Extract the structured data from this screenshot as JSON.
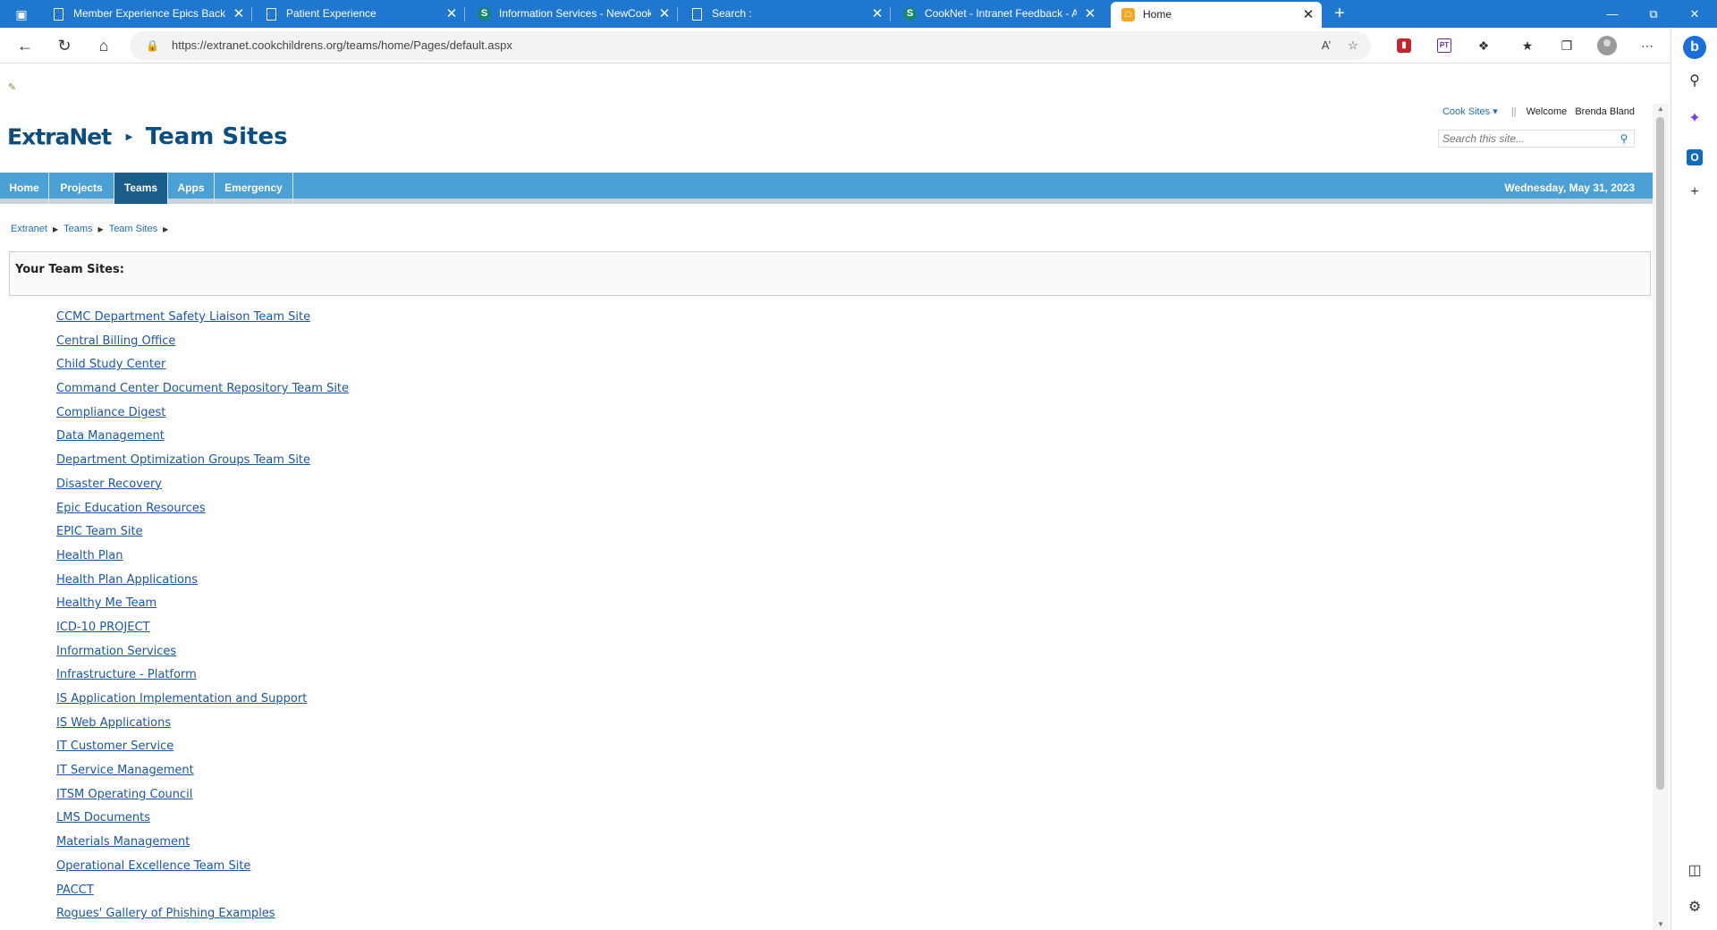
{
  "browser": {
    "tabs": [
      {
        "title": "Member Experience Epics Backlog",
        "icon": "page-icon",
        "active": false
      },
      {
        "title": "Patient Experience",
        "icon": "page-icon",
        "active": false
      },
      {
        "title": "Information Services - NewCookNet",
        "icon": "sharepoint-icon",
        "active": false
      },
      {
        "title": "Search :",
        "icon": "page-icon",
        "active": false
      },
      {
        "title": "CookNet - Intranet Feedback - All",
        "icon": "sharepoint-icon",
        "active": false
      },
      {
        "title": "Home",
        "icon": "home-favicon",
        "active": true
      }
    ],
    "address_url": "https://extranet.cookchildrens.org/teams/home/Pages/default.aspx",
    "accent_color": "#1f77d0"
  },
  "page": {
    "top_links": {
      "sites_menu": "Cook Sites",
      "welcome_label": "Welcome",
      "user_name": "Brenda Bland"
    },
    "brand": {
      "logo_text": "ExtraNet",
      "site_title": "Team Sites"
    },
    "search": {
      "placeholder": "Search this site..."
    },
    "nav": {
      "items": [
        {
          "label": "Home",
          "active": false
        },
        {
          "label": "Projects",
          "active": false
        },
        {
          "label": "Teams",
          "active": true
        },
        {
          "label": "Apps",
          "active": false
        },
        {
          "label": "Emergency",
          "active": false
        }
      ],
      "date": "Wednesday, May 31, 2023",
      "bar_color": "#4ba1d6",
      "active_color": "#1c5e8a"
    },
    "breadcrumb": [
      "Extranet",
      "Teams",
      "Team Sites"
    ],
    "panel_title": "Your Team Sites:",
    "team_sites": [
      "CCMC Department Safety Liaison Team Site",
      "Central Billing Office",
      "Child Study Center",
      "Command Center Document Repository Team Site",
      "Compliance Digest",
      "Data Management",
      "Department Optimization Groups Team Site",
      "Disaster Recovery",
      "Epic Education Resources",
      "EPIC Team Site",
      "Health Plan",
      "Health Plan Applications",
      "Healthy Me Team",
      "ICD-10 PROJECT",
      "Information Services",
      "Infrastructure - Platform",
      "IS Application Implementation and Support",
      "IS Web Applications",
      "IT Customer Service",
      "IT Service Management",
      "ITSM Operating Council",
      "LMS Documents",
      "Materials Management",
      "Operational Excellence Team Site",
      "PACCT",
      "Rogues' Gallery of Phishing Examples"
    ],
    "link_color": "#1a56a6"
  }
}
